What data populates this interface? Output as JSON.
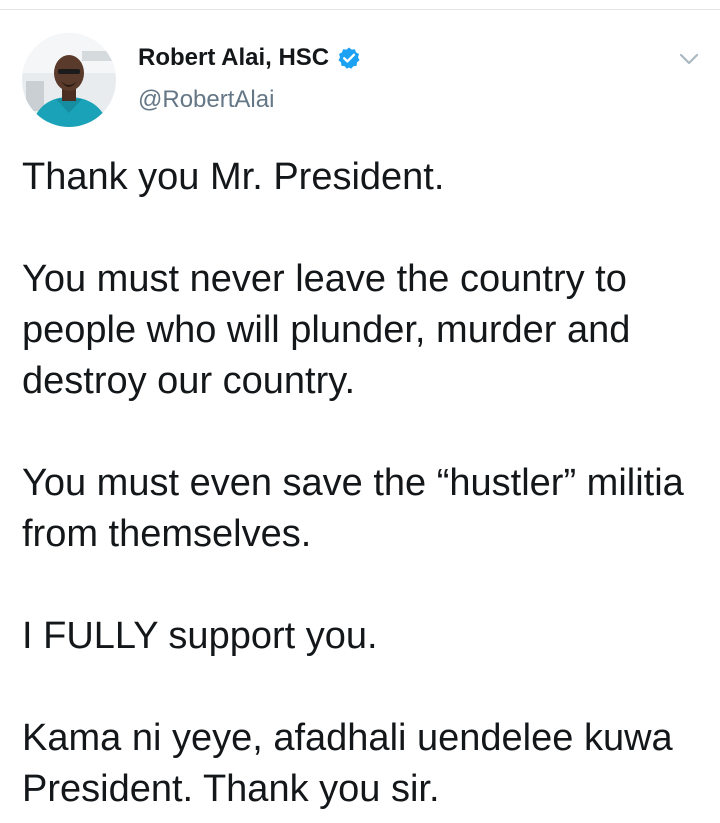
{
  "tweet": {
    "author": {
      "display_name": "Robert Alai, HSC",
      "handle": "@RobertAlai",
      "verified": true
    },
    "paragraphs": [
      "Thank you Mr. President.",
      "You must never leave the country to people who will plunder, murder and destroy our country.",
      "You must even save the “hustler” militia from themselves.",
      "I FULLY support you.",
      "Kama ni yeye, afadhali uendelee kuwa President. Thank you sir."
    ]
  },
  "icons": {
    "verified": "verified-badge-icon",
    "menu": "chevron-down-icon"
  },
  "colors": {
    "text": "#14171a",
    "secondary": "#657786",
    "verified_blue": "#1da1f2"
  }
}
